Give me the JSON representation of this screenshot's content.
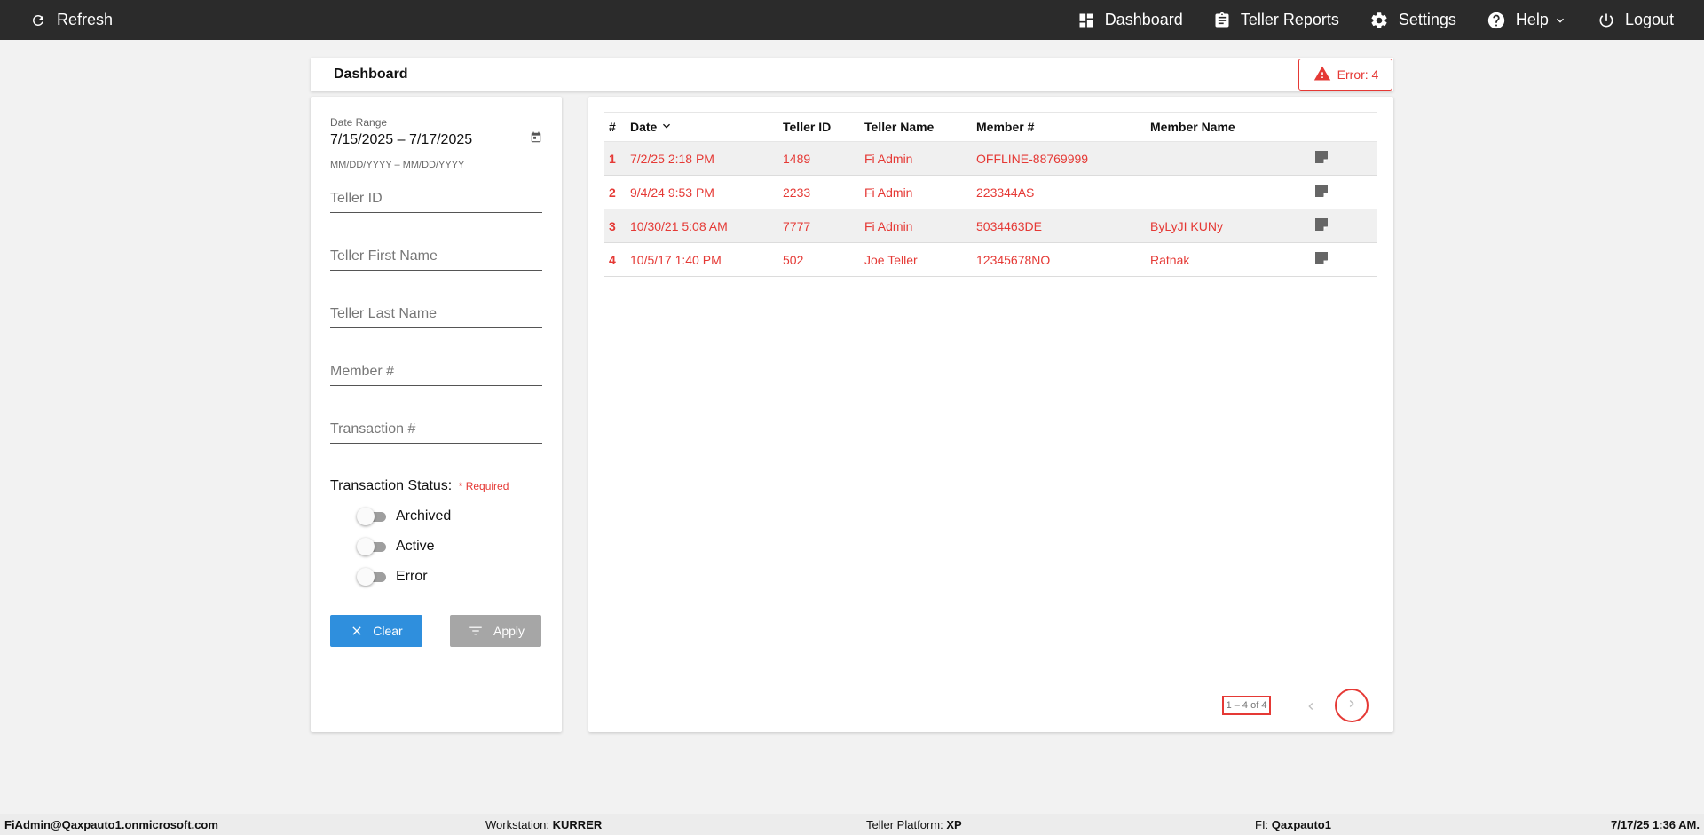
{
  "topbar": {
    "refresh_label": "Refresh",
    "nav": [
      {
        "label": "Dashboard",
        "icon": "dashboard-icon"
      },
      {
        "label": "Teller Reports",
        "icon": "clipboard-icon"
      },
      {
        "label": "Settings",
        "icon": "gear-icon"
      },
      {
        "label": "Help",
        "icon": "help-icon"
      },
      {
        "label": "Logout",
        "icon": "power-icon"
      }
    ]
  },
  "header": {
    "title": "Dashboard",
    "error_label": "Error: 4",
    "error_color": "#e53935"
  },
  "filters": {
    "date_range_label": "Date Range",
    "date_range_value": "7/15/2025 – 7/17/2025",
    "date_range_hint": "MM/DD/YYYY – MM/DD/YYYY",
    "teller_id_placeholder": "Teller ID",
    "teller_first_placeholder": "Teller First Name",
    "teller_last_placeholder": "Teller Last Name",
    "member_placeholder": "Member #",
    "transaction_placeholder": "Transaction #",
    "status_label": "Transaction Status:",
    "required_label": "* Required",
    "toggles": [
      {
        "label": "Archived",
        "on": false
      },
      {
        "label": "Active",
        "on": false
      },
      {
        "label": "Error",
        "on": false
      }
    ],
    "clear_label": "Clear",
    "apply_label": "Apply",
    "clear_color": "#2f8fdd",
    "apply_color": "#a6a6a6"
  },
  "table": {
    "columns": [
      "#",
      "Date",
      "Teller ID",
      "Teller Name",
      "Member #",
      "Member Name"
    ],
    "rows": [
      {
        "num": "1",
        "date": "7/2/25 2:18 PM",
        "teller_id": "1489",
        "teller_name": "Fi Admin",
        "member": "OFFLINE-88769999",
        "member_name": ""
      },
      {
        "num": "2",
        "date": "9/4/24 9:53 PM",
        "teller_id": "2233",
        "teller_name": "Fi Admin",
        "member": "223344AS",
        "member_name": ""
      },
      {
        "num": "3",
        "date": "10/30/21 5:08 AM",
        "teller_id": "7777",
        "teller_name": "Fi Admin",
        "member": "5034463DE",
        "member_name": "ByLyJI KUNy"
      },
      {
        "num": "4",
        "date": "10/5/17 1:40 PM",
        "teller_id": "502",
        "teller_name": "Joe Teller",
        "member": "12345678NO",
        "member_name": "Ratnak"
      }
    ],
    "row_text_color": "#e53935",
    "range_label": "1 – 4 of 4"
  },
  "footer": {
    "user": "FiAdmin@Qaxpauto1.onmicrosoft.com",
    "workstation_label": "Workstation:",
    "workstation_value": "KURRER",
    "platform_label": "Teller Platform:",
    "platform_value": "XP",
    "fi_label": "FI:",
    "fi_value": "Qaxpauto1",
    "datetime": "7/17/25 1:36 AM."
  }
}
